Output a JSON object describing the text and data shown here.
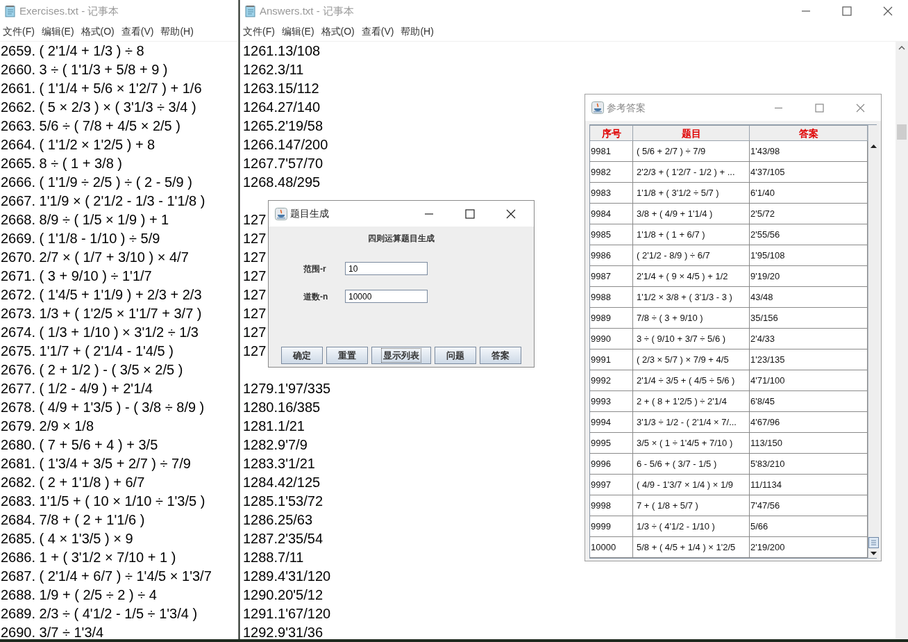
{
  "exercises_window": {
    "title": "Exercises.txt - 记事本",
    "menu": [
      "文件(F)",
      "编辑(E)",
      "格式(O)",
      "查看(V)",
      "帮助(H)"
    ],
    "lines": [
      "2659. ( 2'1/4 + 1/3 ) ÷ 8",
      "2660. 3 ÷ ( 1'1/3 + 5/8 + 9 )",
      "2661. ( 1'1/4 + 5/6 × 1'2/7 ) + 1/6",
      "2662. ( 5 × 2/3 ) × ( 3'1/3 ÷ 3/4 )",
      "2663. 5/6 ÷ ( 7/8 + 4/5 × 2/5 )",
      "2664. ( 1'1/2 × 1'2/5 ) + 8",
      "2665. 8 ÷ ( 1 + 3/8 )",
      "2666. ( 1'1/9 ÷ 2/5 ) ÷ ( 2 - 5/9 )",
      "2667. 1'1/9 × ( 2'1/2 - 1/3 - 1'1/8 )",
      "2668. 8/9 ÷ ( 1/5 × 1/9 ) + 1",
      "2669. ( 1'1/8 - 1/10 ) ÷ 5/9",
      "2670. 2/7 × ( 1/7 + 3/10 ) × 4/7",
      "2671. ( 3 + 9/10 ) ÷ 1'1/7",
      "2672. ( 1'4/5 + 1'1/9 ) + 2/3 + 2/3",
      "2673. 1/3 + ( 1'2/5 × 1'1/7 + 3/7 )",
      "2674. ( 1/3 + 1/10 ) × 3'1/2 ÷ 1/3",
      "2675. 1'1/7 + ( 2'1/4 - 1'4/5 )",
      "2676. ( 2 + 1/2 ) - ( 3/5 × 2/5 )",
      "2677. ( 1/2 - 4/9 ) + 2'1/4",
      "2678. ( 4/9 + 1'3/5 ) - ( 3/8 ÷ 8/9 )",
      "2679. 2/9 × 1/8",
      "2680. ( 7 + 5/6 + 4 ) + 3/5",
      "2681. ( 1'3/4 + 3/5 + 2/7 ) ÷ 7/9",
      "2682. ( 2 + 1'1/8 ) + 6/7",
      "2683. 1'1/5 + ( 10 × 1/10 ÷ 1'3/5 )",
      "2684. 7/8 + ( 2 + 1'1/6 )",
      "2685. ( 4 × 1'3/5 ) × 9",
      "2686. 1 + ( 3'1/2 × 7/10 + 1 )",
      "2687. ( 2'1/4 + 6/7 ) ÷ 1'4/5 × 1'3/7",
      "2688. 1/9 + ( 2/5 ÷ 2 ) ÷ 4",
      "2689. 2/3 ÷ ( 4'1/2 - 1/5 ÷ 1'3/4 )",
      "2690. 3/7 ÷ 1'3/4"
    ]
  },
  "answers_window": {
    "title": "Answers.txt - 记事本",
    "menu": [
      "文件(F)",
      "编辑(E)",
      "格式(O)",
      "查看(V)",
      "帮助(H)"
    ],
    "lines_above_dialog": [
      "1261.13/108",
      "1262.3/11",
      "1263.15/112",
      "1264.27/140",
      "1265.2'19/58",
      "1266.147/200",
      "1267.7'57/70",
      "1268.48/295"
    ],
    "lines_beside_dialog": [
      "127",
      "127",
      "127",
      "127",
      "127",
      "127",
      "127",
      "127"
    ],
    "lines_below_dialog": [
      "1279.1'97/335",
      "1280.16/385",
      "1281.1/21",
      "1282.9'7/9",
      "1283.3'1/21",
      "1284.42/125",
      "1285.1'53/72",
      "1286.25/63",
      "1287.2'35/54",
      "1288.7/11",
      "1289.4'31/120",
      "1290.20'5/12",
      "1291.1'67/120",
      "1292.9'31/36"
    ]
  },
  "generator_dialog": {
    "title": "题目生成",
    "heading": "四则运算题目生成",
    "fields": [
      {
        "label": "范围-r",
        "value": "10"
      },
      {
        "label": "道数-n",
        "value": "10000"
      }
    ],
    "buttons": [
      {
        "label": "确定",
        "focused": false
      },
      {
        "label": "重置",
        "focused": false
      },
      {
        "label": "显示列表",
        "focused": true
      },
      {
        "label": "问题",
        "focused": false
      },
      {
        "label": "答案",
        "focused": false
      }
    ]
  },
  "answer_table_window": {
    "title": "参考答案",
    "columns": [
      "序号",
      "题目",
      "答案"
    ],
    "rows": [
      [
        "9981",
        "( 5/6 + 2/7 ) ÷ 7/9",
        "1'43/98"
      ],
      [
        "9982",
        "2'2/3 + ( 1'2/7 - 1/2 ) + ...",
        "4'37/105"
      ],
      [
        "9983",
        "1'1/8 + ( 3'1/2 ÷ 5/7 )",
        "6'1/40"
      ],
      [
        "9984",
        "3/8 + ( 4/9 + 1'1/4 )",
        "2'5/72"
      ],
      [
        "9985",
        "1'1/8 + ( 1 + 6/7 )",
        "2'55/56"
      ],
      [
        "9986",
        "( 2'1/2 - 8/9 ) ÷ 6/7",
        "1'95/108"
      ],
      [
        "9987",
        "2'1/4 + ( 9 × 4/5 ) + 1/2",
        "9'19/20"
      ],
      [
        "9988",
        "1'1/2 × 3/8 + ( 3'1/3 - 3 )",
        "43/48"
      ],
      [
        "9989",
        "7/8 ÷ ( 3 + 9/10 )",
        "35/156"
      ],
      [
        "9990",
        "3 ÷ ( 9/10 + 3/7 ÷ 5/6 )",
        "2'4/33"
      ],
      [
        "9991",
        "( 2/3 × 5/7 ) × 7/9 + 4/5",
        "1'23/135"
      ],
      [
        "9992",
        "2'1/4 ÷ 3/5 + ( 4/5 ÷ 5/6 )",
        "4'71/100"
      ],
      [
        "9993",
        "2 + ( 8 + 1'2/5 ) ÷ 2'1/4",
        "6'8/45"
      ],
      [
        "9994",
        "3'1/3 ÷ 1/2 - ( 2'1/4 × 7/...",
        "4'67/96"
      ],
      [
        "9995",
        "3/5 × ( 1 ÷ 1'4/5 + 7/10 )",
        "113/150"
      ],
      [
        "9996",
        "6 - 5/6 + ( 3/7 - 1/5 )",
        "5'83/210"
      ],
      [
        "9997",
        "( 4/9 - 1'3/7 × 1/4 ) × 1/9",
        "11/1134"
      ],
      [
        "9998",
        "7 + ( 1/8 + 5/7 )",
        "7'47/56"
      ],
      [
        "9999",
        "1/3 ÷ ( 4'1/2 - 1/10 )",
        "5/66"
      ],
      [
        "10000",
        "5/8 + ( 4/5 + 1/4 ) × 1'2/5",
        "2'19/200"
      ]
    ]
  }
}
